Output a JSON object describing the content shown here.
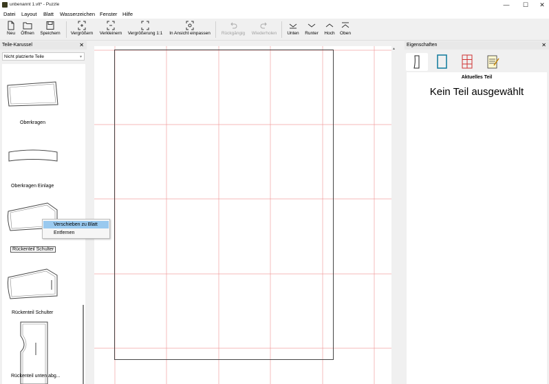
{
  "window": {
    "title": "unbenannt 1.vlt* - Puzzle",
    "min": "—",
    "max": "☐",
    "close": "✕"
  },
  "menu": [
    "Datei",
    "Layout",
    "Blatt",
    "Wasserzeichen",
    "Fenster",
    "Hilfe"
  ],
  "toolbar": {
    "neu": "Neu",
    "oeffnen": "Öffnen",
    "speichern": "Speichern",
    "vergroessern": "Vergrößern",
    "verkleinern": "Verkleinern",
    "vergroesserung": "Vergrößerung 1:1",
    "einpassen": "In Ansicht einpassen",
    "rueckgaengig": "Rückgängig",
    "wiederholen": "Wiederholen",
    "unten": "Unten",
    "runter": "Runter",
    "hoch": "Hoch",
    "oben": "Oben"
  },
  "left_panel": {
    "title": "Teile-Karussel",
    "filter_value": "Nicht platzierte Teile",
    "pieces": [
      "Oberkragen",
      "Oberkragen Einlage",
      "Rückenteil Schulter",
      "Rückenteil Schulter",
      "Rückenteil unten abg..."
    ]
  },
  "context_menu": {
    "move_to_sheet": "Verschieben zu Blatt",
    "remove": "Entfernen"
  },
  "right_panel": {
    "title": "Eigenschaften",
    "subtitle": "Aktuelles Teil",
    "message": "Kein Teil ausgewählt"
  },
  "colors": {
    "grid_line": "#f2a0a0",
    "active_tab": "#1a7fa0",
    "highlight": "#99c9ef"
  }
}
